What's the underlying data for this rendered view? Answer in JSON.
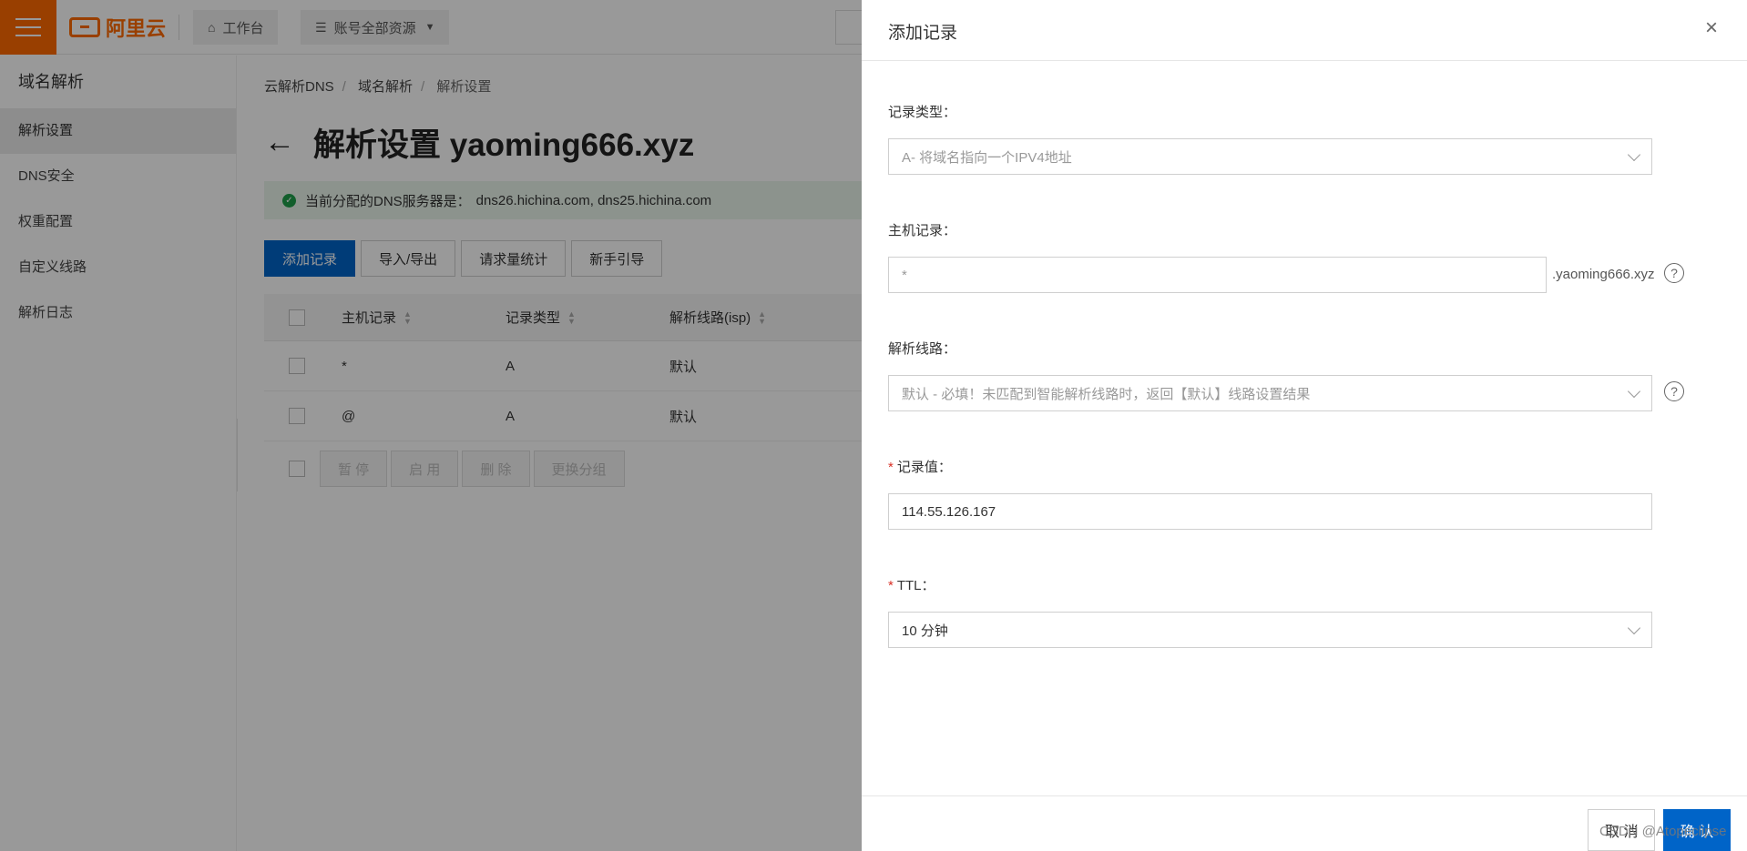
{
  "topbar": {
    "logo_text": "阿里云",
    "workbench_label": "工作台",
    "resources_label": "账号全部资源"
  },
  "sidebar": {
    "title": "域名解析",
    "items": [
      {
        "label": "解析设置",
        "active": true
      },
      {
        "label": "DNS安全",
        "active": false
      },
      {
        "label": "权重配置",
        "active": false
      },
      {
        "label": "自定义线路",
        "active": false
      },
      {
        "label": "解析日志",
        "active": false
      }
    ]
  },
  "breadcrumb": [
    "云解析DNS",
    "域名解析",
    "解析设置"
  ],
  "page": {
    "title": "解析设置 yaoming666.xyz",
    "notice_label": "当前分配的DNS服务器是：",
    "notice_value": "dns26.hichina.com, dns25.hichina.com"
  },
  "actions": [
    "添加记录",
    "导入/导出",
    "请求量统计",
    "新手引导"
  ],
  "table": {
    "headers": [
      "主机记录",
      "记录类型",
      "解析线路(isp)"
    ],
    "rows": [
      {
        "host": "*",
        "type": "A",
        "line": "默认"
      },
      {
        "host": "@",
        "type": "A",
        "line": "默认"
      }
    ],
    "bulk_actions": [
      "暂 停",
      "启 用",
      "删 除",
      "更换分组"
    ]
  },
  "drawer": {
    "title": "添加记录",
    "record_type_label": "记录类型：",
    "record_type_value": "A- 将域名指向一个IPV4地址",
    "host_label": "主机记录：",
    "host_value": "*",
    "host_suffix": ".yaoming666.xyz",
    "line_label": "解析线路：",
    "line_value": "默认 - 必填！未匹配到智能解析线路时，返回【默认】线路设置结果",
    "value_label": "记录值：",
    "value_value": "114.55.126.167",
    "ttl_label": "TTL：",
    "ttl_value": "10 分钟",
    "cancel_label": "取 消",
    "confirm_label": "确 认"
  },
  "watermark": "CSDN @Atopeclipse",
  "colors": {
    "brand": "#ff6a00",
    "primary": "#0064c8",
    "success": "#1e9f4a"
  }
}
